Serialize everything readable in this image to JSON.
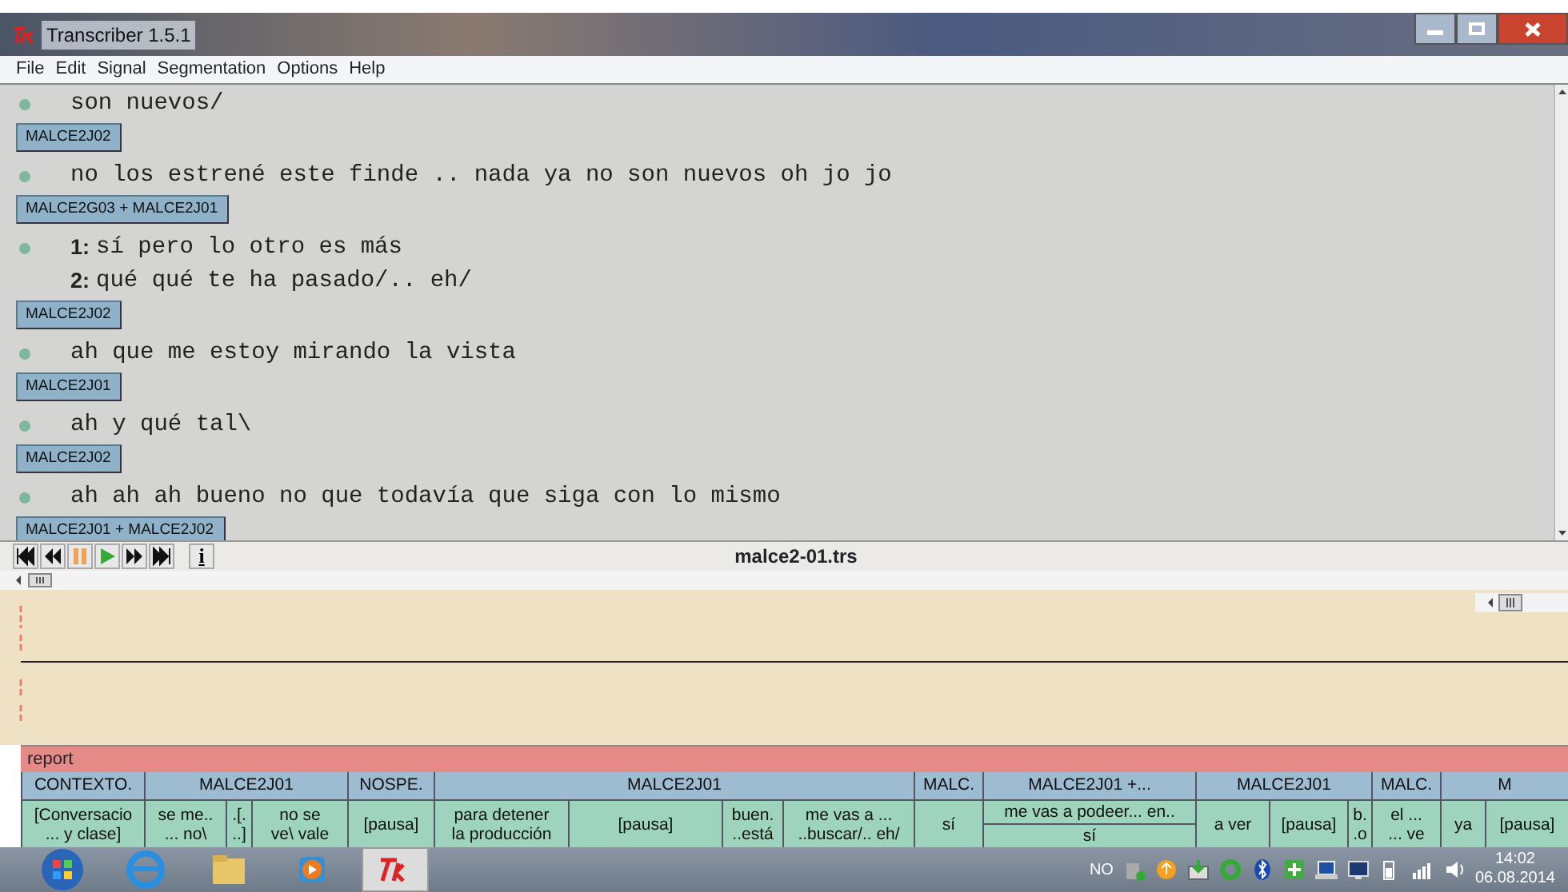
{
  "window": {
    "title": "Transcriber 1.5.1"
  },
  "menu": [
    "File",
    "Edit",
    "Signal",
    "Segmentation",
    "Options",
    "Help"
  ],
  "transcript": [
    {
      "kind": "utterance",
      "text": "son nuevos/"
    },
    {
      "kind": "speaker",
      "text": "MALCE2J02"
    },
    {
      "kind": "utterance",
      "text": "no los estrené este finde .. nada ya no son nuevos oh jo jo"
    },
    {
      "kind": "speaker",
      "text": "MALCE2G03 + MALCE2J01"
    },
    {
      "kind": "overlap",
      "lines": [
        {
          "number": "1:",
          "text": "sí pero lo otro es más"
        },
        {
          "number": "2:",
          "text": "qué qué te ha pasado/.. eh/"
        }
      ]
    },
    {
      "kind": "speaker",
      "text": "MALCE2J02"
    },
    {
      "kind": "utterance",
      "text": "ah que me estoy mirando la vista"
    },
    {
      "kind": "speaker",
      "text": "MALCE2J01"
    },
    {
      "kind": "utterance",
      "text": "ah y qué tal\\"
    },
    {
      "kind": "speaker",
      "text": "MALCE2J02"
    },
    {
      "kind": "utterance",
      "text": "ah ah ah bueno no que todavía que siga con lo mismo"
    },
    {
      "kind": "speaker",
      "text": "MALCE2J01 + MALCE2J02"
    }
  ],
  "player": {
    "file": "malce2-01.trs",
    "info": "i"
  },
  "report": "report",
  "speakers": [
    {
      "text": "CONTEXTO.",
      "kind": "single",
      "segments": [
        "[Conversacio\n... y clase]"
      ]
    },
    {
      "text": "MALCE2J01",
      "kind": "single",
      "segments": [
        "se me..\n... no\\",
        ".[.\n..]",
        "no se\nve\\ vale"
      ]
    },
    {
      "text": "NOSPE.",
      "kind": "single",
      "segments": [
        "[pausa]"
      ]
    },
    {
      "text": "MALCE2J01",
      "kind": "single",
      "segments": [
        "para detener\nla producción",
        "[pausa]",
        "buen.\n..está",
        "me vas a ...\n..buscar/.. eh/"
      ]
    },
    {
      "text": "MALC.",
      "kind": "single",
      "segments": [
        "sí"
      ]
    },
    {
      "text": "MALCE2J01 +...",
      "kind": "overlap",
      "segments": [
        "me vas a podeer... en..",
        "sí"
      ]
    },
    {
      "text": "MALCE2J01",
      "kind": "single",
      "segments": [
        "a ver",
        "[pausa]",
        "b.\n.o"
      ]
    },
    {
      "text": "MALC.",
      "kind": "single",
      "segments": [
        "el ...\n... ve"
      ]
    },
    {
      "text": "M",
      "kind": "single",
      "segments": [
        "ya",
        "[pausa]"
      ]
    }
  ],
  "taskbar": {
    "apps": [
      {
        "kind": "start",
        "selected": false
      },
      {
        "kind": "browser",
        "selected": false
      },
      {
        "kind": "folder",
        "selected": false
      },
      {
        "kind": "media",
        "selected": false
      },
      {
        "kind": "tk",
        "selected": true
      }
    ],
    "language": "NO",
    "time": "14:02",
    "date": "06.08.2014"
  }
}
